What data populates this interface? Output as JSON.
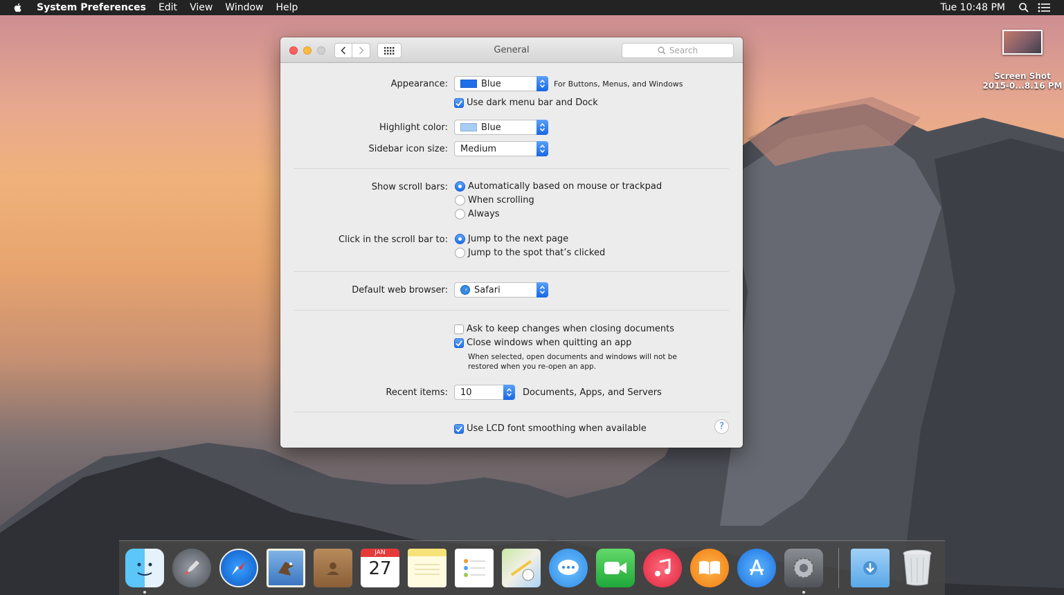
{
  "menubar": {
    "app_name": "System Preferences",
    "menus": [
      "Edit",
      "View",
      "Window",
      "Help"
    ],
    "clock": "Tue 10:48 PM"
  },
  "desktop": {
    "icon_label_line1": "Screen Shot",
    "icon_label_line2": "2015-0...8.16 PM"
  },
  "window": {
    "title": "General",
    "search_placeholder": "Search",
    "appearance": {
      "label": "Appearance:",
      "value": "Blue",
      "swatch_color": "#1f6fe9",
      "note": "For Buttons, Menus, and Windows"
    },
    "dark_menu": {
      "label": "Use dark menu bar and Dock",
      "checked": true
    },
    "highlight": {
      "label": "Highlight color:",
      "value": "Blue",
      "swatch_color": "#a9cdf7"
    },
    "sidebar_size": {
      "label": "Sidebar icon size:",
      "value": "Medium"
    },
    "scroll_bars": {
      "label": "Show scroll bars:",
      "options": [
        "Automatically based on mouse or trackpad",
        "When scrolling",
        "Always"
      ],
      "selected": 0
    },
    "click_scroll": {
      "label": "Click in the scroll bar to:",
      "options": [
        "Jump to the next page",
        "Jump to the spot that’s clicked"
      ],
      "selected": 0
    },
    "browser": {
      "label": "Default web browser:",
      "value": "Safari"
    },
    "ask_keep": {
      "label": "Ask to keep changes when closing documents",
      "checked": false
    },
    "close_windows": {
      "label": "Close windows when quitting an app",
      "checked": true,
      "note_line1": "When selected, open documents and windows will not be",
      "note_line2": "restored when you re-open an app."
    },
    "recent": {
      "label": "Recent items:",
      "value": "10",
      "suffix": "Documents, Apps, and Servers"
    },
    "lcd": {
      "label": "Use LCD font smoothing when available",
      "checked": true
    },
    "help_glyph": "?"
  },
  "dock": {
    "calendar_month": "JAN",
    "calendar_day": "27",
    "apps": [
      "finder-icon",
      "launchpad-icon",
      "safari-icon",
      "mail-icon",
      "contacts-icon",
      "calendar-icon",
      "notes-icon",
      "reminders-icon",
      "maps-icon",
      "messages-icon",
      "facetime-icon",
      "itunes-icon",
      "ibooks-icon",
      "app-store-icon",
      "system-preferences-icon",
      "downloads-folder-icon",
      "trash-icon"
    ]
  }
}
